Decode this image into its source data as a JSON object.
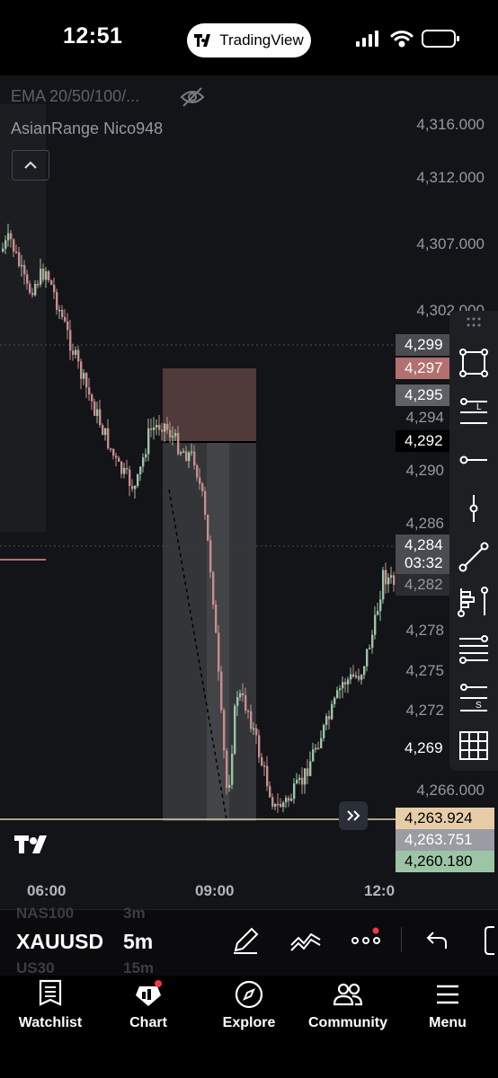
{
  "status_bar": {
    "time": "12:51",
    "app_pill": "TradingView"
  },
  "indicators": {
    "ema": "EMA 20/50/100/...",
    "asian_range": "AsianRange Nico948"
  },
  "price_axis": [
    "4,316.000",
    "4,312.000",
    "4,307.000",
    "4,302.000",
    "4,294",
    "4,290",
    "4,286",
    "4,278",
    "4,275",
    "4,272",
    "4,266.000"
  ],
  "price_tags": [
    {
      "value": "4,299",
      "bg": "#4a4c52"
    },
    {
      "value": "4,297",
      "bg": "#b2706f"
    },
    {
      "value": "4,295",
      "bg": "#5f6168"
    },
    {
      "value": "4,292",
      "bg": "#000000"
    },
    {
      "value": "4,284",
      "bg": "#4a4c52"
    },
    {
      "value": "03:32",
      "bg": "#4a4c52"
    },
    {
      "value": "4,282",
      "bg": "#2a2c31"
    },
    {
      "value": "4,269",
      "bg": "#131418"
    },
    {
      "value": "4,263.924",
      "bg": "#e6cda8"
    },
    {
      "value": "4,263.751",
      "bg": "#9a9ca3"
    },
    {
      "value": "4,260.180",
      "bg": "#9cc5a6"
    }
  ],
  "time_axis": [
    "06:00",
    "09:00",
    "12:0"
  ],
  "symbol_bar": {
    "symbol_prev": "NAS100",
    "symbol": "XAUUSD",
    "symbol_next": "US30",
    "tf_prev": "3m",
    "tf": "5m",
    "tf_next": "15m"
  },
  "tabs": [
    {
      "label": "Watchlist",
      "icon": "watchlist-icon"
    },
    {
      "label": "Chart",
      "icon": "chart-icon"
    },
    {
      "label": "Explore",
      "icon": "compass-icon"
    },
    {
      "label": "Community",
      "icon": "community-icon"
    },
    {
      "label": "Menu",
      "icon": "menu-icon"
    }
  ],
  "colors": {
    "bull": "#9cc5a6",
    "bear": "#c98e8e",
    "accent_red": "#f23645"
  }
}
